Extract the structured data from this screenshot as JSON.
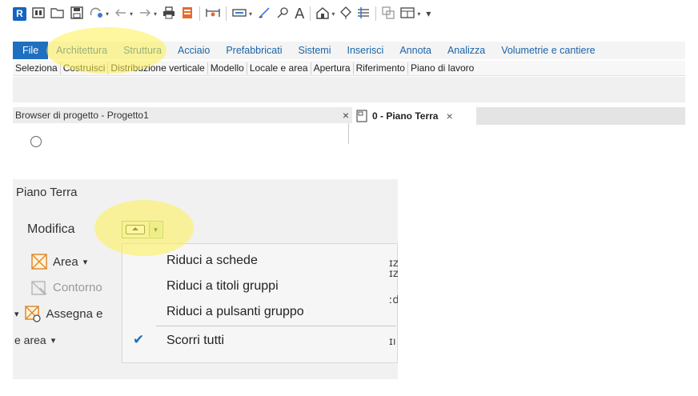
{
  "quick_access": {
    "logo_letter": "R",
    "icons": [
      "info-icon",
      "open-folder-icon",
      "save-icon",
      "sync-icon",
      "undo-icon",
      "redo-icon",
      "print-icon",
      "document-icon",
      "measure-icon",
      "level-icon",
      "tag-icon",
      "dimension-icon",
      "text-icon",
      "home-icon",
      "point-icon",
      "grid-icon",
      "switch-icon",
      "window-icon",
      "customize-icon"
    ]
  },
  "menu_tabs": [
    "File",
    "Architettura",
    "Struttura",
    "Acciaio",
    "Prefabbricati",
    "Sistemi",
    "Inserisci",
    "Annota",
    "Analizza",
    "Volumetrie e cantiere"
  ],
  "sub_tabs": [
    "Seleziona",
    "Costruisci",
    "Distribuzione verticale",
    "Modello",
    "Locale e area",
    "Apertura",
    "Riferimento",
    "Piano di lavoro"
  ],
  "project_browser": {
    "title": "Browser di progetto - Progetto1",
    "close": "×"
  },
  "view_tab": {
    "title": "0 - Piano Terra",
    "close": "×"
  },
  "zoom_panel": {
    "view_name": "Piano Terra",
    "modify_label": "Modifica",
    "ribbon": {
      "area": "Area",
      "contorno": "Contorno",
      "assegna": "Assegna e",
      "area_group": "e area"
    },
    "dropdown_items": [
      "Riduci a schede",
      "Riduci a titoli gruppi",
      "Riduci a pulsanti gruppo",
      "Scorri tutti"
    ],
    "checked_item": "Scorri tutti",
    "right_fragments": [
      "ɪz",
      "ɪz",
      "ːd",
      "ɪı"
    ]
  },
  "colors": {
    "file_tab": "#1f6fc0",
    "highlight": "#fff050",
    "check": "#1f6fc0"
  }
}
